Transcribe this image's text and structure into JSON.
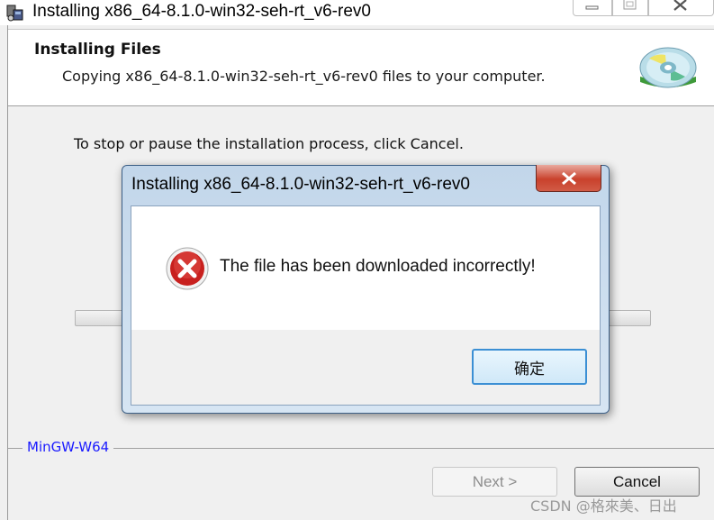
{
  "window": {
    "title": "Installing x86_64-8.1.0-win32-seh-rt_v6-rev0",
    "controls": {
      "minimize_icon": "minimize-icon",
      "maximize_icon": "maximize-icon",
      "close_icon": "close-icon"
    }
  },
  "header": {
    "title": "Installing Files",
    "subtitle": "Copying x86_64-8.1.0-win32-seh-rt_v6-rev0 files to your computer.",
    "icon": "cd-disc-icon"
  },
  "main": {
    "instruction": "To stop or pause the installation process, click Cancel.",
    "progress": 0
  },
  "footer": {
    "brand": "MinGW-W64",
    "next_label": "Next >",
    "cancel_label": "Cancel"
  },
  "dialog": {
    "title": "Installing x86_64-8.1.0-win32-seh-rt_v6-rev0",
    "message": "The file has been downloaded incorrectly!",
    "icon": "error-icon",
    "ok_label": "确定"
  },
  "watermark": "CSDN @格來美、日出",
  "colors": {
    "brand_text": "#1a1aff",
    "dialog_frame": "#c2d6ea",
    "close_button": "#c9412c",
    "error_red": "#c8201e",
    "ok_focus": "#3b8fd4"
  }
}
